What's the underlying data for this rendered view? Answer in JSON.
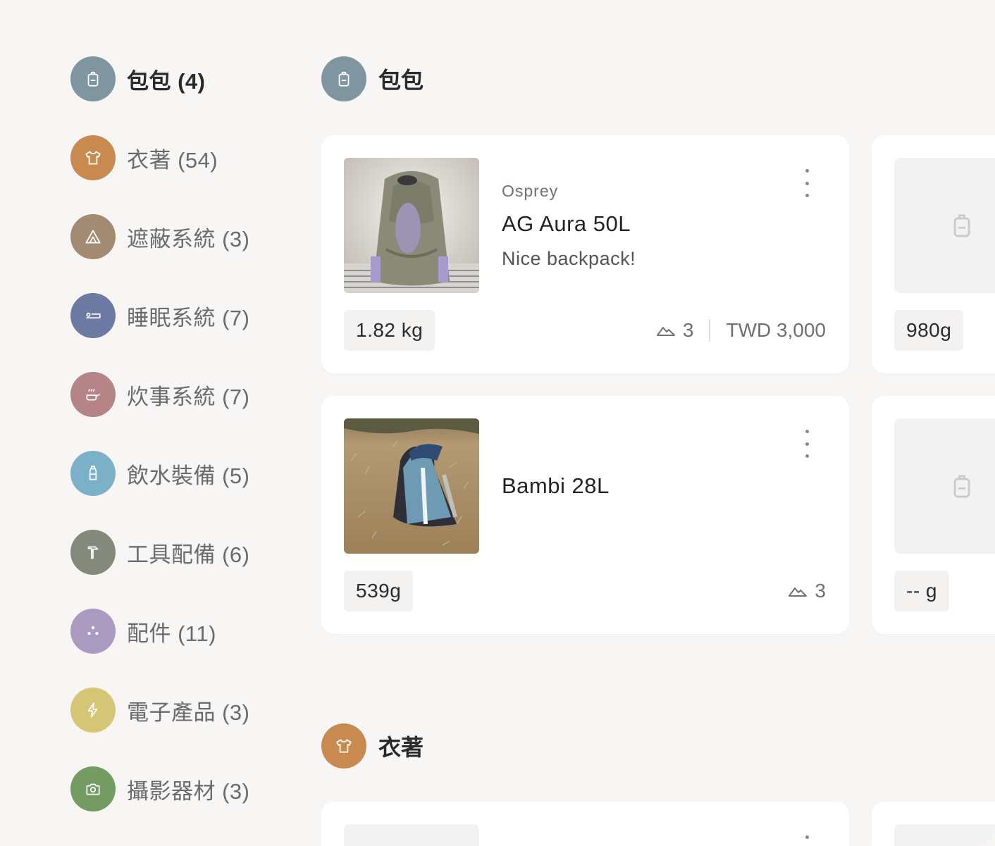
{
  "sidebar": {
    "items": [
      {
        "label": "包包 (4)",
        "icon": "backpack-icon",
        "color": "#7f95a0",
        "active": true
      },
      {
        "label": "衣著 (54)",
        "icon": "shirt-icon",
        "color": "#c98a4f"
      },
      {
        "label": "遮蔽系統 (3)",
        "icon": "tent-icon",
        "color": "#a38a72"
      },
      {
        "label": "睡眠系統 (7)",
        "icon": "bed-icon",
        "color": "#6d7aa4"
      },
      {
        "label": "炊事系統 (7)",
        "icon": "stove-icon",
        "color": "#b68487"
      },
      {
        "label": "飲水裝備 (5)",
        "icon": "bottle-icon",
        "color": "#7bb1c8"
      },
      {
        "label": "工具配備 (6)",
        "icon": "hammer-icon",
        "color": "#838a7b"
      },
      {
        "label": "配件 (11)",
        "icon": "dots-icon",
        "color": "#ab9ac0"
      },
      {
        "label": "電子產品 (3)",
        "icon": "bolt-icon",
        "color": "#d5c675"
      },
      {
        "label": "攝影器材 (3)",
        "icon": "camera-icon",
        "color": "#749b61"
      }
    ]
  },
  "main": {
    "sections": [
      {
        "title": "包包",
        "icon": "backpack-icon",
        "color": "#7f95a0",
        "items": [
          {
            "brand": "Osprey",
            "name": "AG Aura 50L",
            "note": "Nice backpack!",
            "weight": "1.82 kg",
            "trips": "3",
            "price": "TWD 3,000"
          },
          {
            "brand": "",
            "name": "Bambi 28L",
            "note": "",
            "weight": "539g",
            "trips": "3",
            "price": ""
          },
          {
            "weight": "980g"
          },
          {
            "weight": "-- g"
          }
        ]
      },
      {
        "title": "衣著",
        "icon": "shirt-icon",
        "color": "#c98a4f"
      }
    ]
  }
}
